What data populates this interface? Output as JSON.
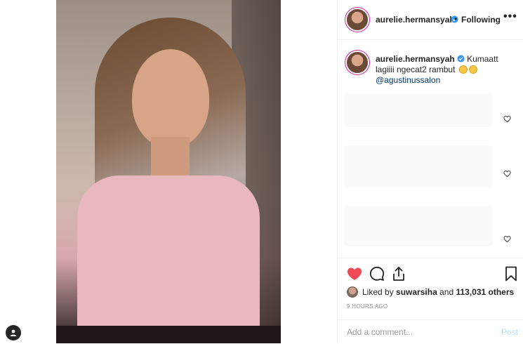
{
  "post": {
    "username": "aurelie.hermansyah",
    "verified_icon": "verified-badge-icon",
    "follow_separator": "•",
    "follow_status": "Following",
    "more_icon": "•••"
  },
  "caption": {
    "username": "aurelie.hermansyah",
    "text": "Kumaatt lagiiii ngecat2 rambut",
    "emojis": [
      "grimacing-face",
      "smiling-face-with-heart-eyes"
    ],
    "mention": "@agustinussalon"
  },
  "actions": {
    "like_icon": "heart-filled-icon",
    "comment_icon": "comment-icon",
    "share_icon": "share-icon",
    "save_icon": "bookmark-icon",
    "like_color": "#ed4956"
  },
  "likes": {
    "prefix": "Liked by",
    "first_liker": "suwarsiha",
    "joiner": "and",
    "others_count": "113,031 others"
  },
  "timestamp": "9 HOURS AGO",
  "comment": {
    "placeholder": "Add a comment...",
    "post_label": "Post"
  }
}
